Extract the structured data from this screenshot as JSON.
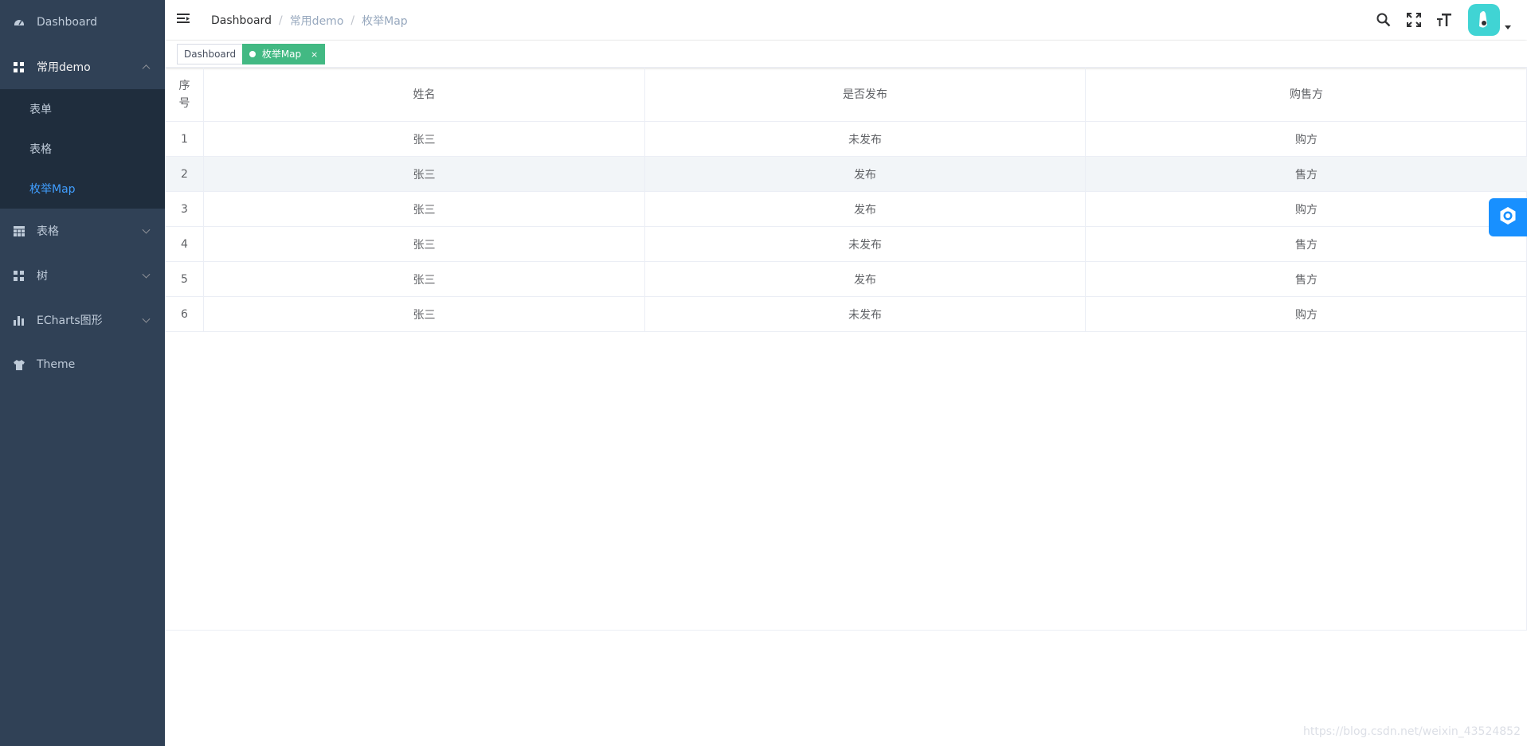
{
  "sidebar": {
    "items": [
      {
        "label": "Dashboard",
        "icon": "dashboard-icon"
      },
      {
        "label": "常用demo",
        "icon": "grid-icon",
        "expanded": true,
        "children": [
          {
            "label": "表单"
          },
          {
            "label": "表格"
          },
          {
            "label": "枚举Map",
            "active": true
          }
        ]
      },
      {
        "label": "表格",
        "icon": "table-icon"
      },
      {
        "label": "树",
        "icon": "tree-icon"
      },
      {
        "label": "ECharts图形",
        "icon": "bar-chart-icon"
      },
      {
        "label": "Theme",
        "icon": "shirt-icon"
      }
    ]
  },
  "header": {
    "breadcrumb": [
      "Dashboard",
      "常用demo",
      "枚举Map"
    ],
    "separator": "/"
  },
  "tags": [
    {
      "label": "Dashboard"
    },
    {
      "label": "枚举Map",
      "active": true,
      "close": "×"
    }
  ],
  "table": {
    "headers": [
      "序号",
      "姓名",
      "是否发布",
      "购售方"
    ],
    "rows": [
      [
        "1",
        "张三",
        "未发布",
        "购方"
      ],
      [
        "2",
        "张三",
        "发布",
        "售方"
      ],
      [
        "3",
        "张三",
        "发布",
        "购方"
      ],
      [
        "4",
        "张三",
        "未发布",
        "售方"
      ],
      [
        "5",
        "张三",
        "发布",
        "售方"
      ],
      [
        "6",
        "张三",
        "未发布",
        "购方"
      ]
    ]
  },
  "watermark": "https://blog.csdn.net/weixin_43524852",
  "colors": {
    "sidebar_bg": "#304156",
    "submenu_bg": "#1f2d3d",
    "accent": "#409eff",
    "tag_active": "#42b983",
    "settings": "#1890ff"
  }
}
